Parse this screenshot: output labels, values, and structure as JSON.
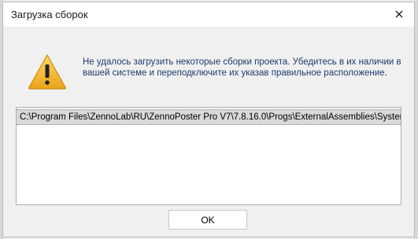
{
  "window": {
    "title": "Загрузка сборок"
  },
  "icons": {
    "close": "close-icon",
    "warning": "warning-icon"
  },
  "message": "Не удалось загрузить некоторые сборки проекта. Убедитесь в их наличии в вашей системе и переподключите их указав правильное расположение.",
  "assemblies": [
    "C:\\Program Files\\ZennoLab\\RU\\ZennoPoster Pro V7\\7.8.16.0\\Progs\\ExternalAssemblies\\System.Dat"
  ],
  "buttons": {
    "ok_label": "OK"
  }
}
